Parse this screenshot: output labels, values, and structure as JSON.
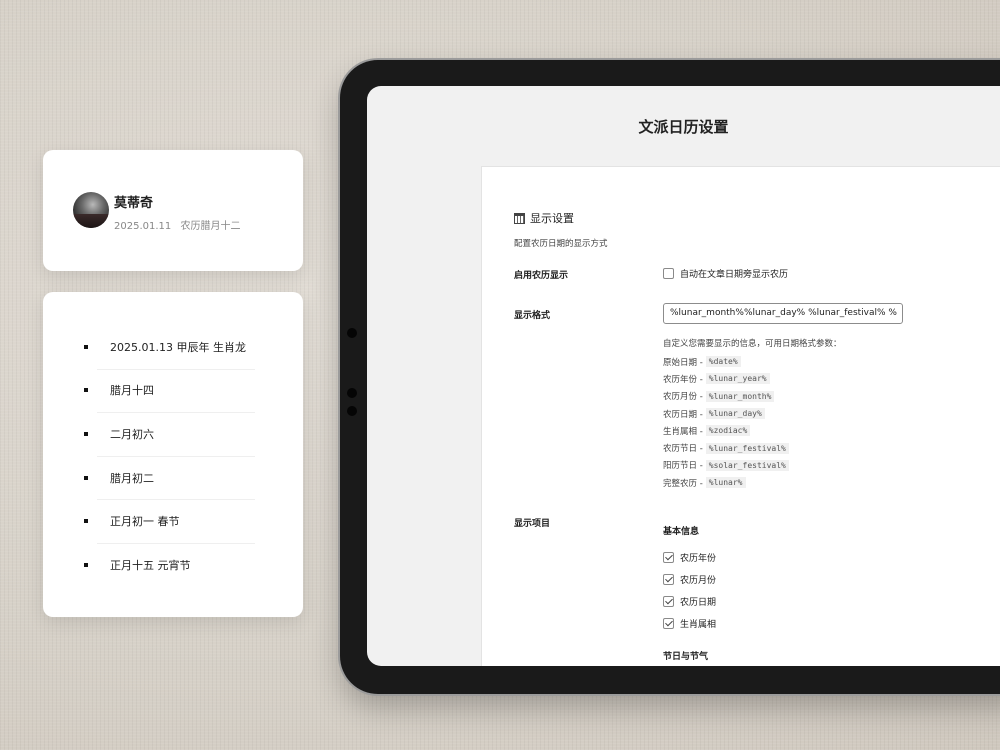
{
  "profile": {
    "name": "莫蒂奇",
    "date": "2025.01.11",
    "lunar": "农历腊月十二"
  },
  "lunar_list": [
    "2025.01.13 甲辰年 生肖龙",
    "腊月十四",
    "二月初六",
    "腊月初二",
    "正月初一 春节",
    "正月十五 元宵节"
  ],
  "settings": {
    "page_title": "文派日历设置",
    "section_title": "显示设置",
    "section_icon": "calendar-icon",
    "section_desc": "配置农历日期的显示方式",
    "enable_label": "启用农历显示",
    "enable_checkbox_label": "自动在文章日期旁显示农历",
    "enable_checked": false,
    "format_label": "显示格式",
    "format_value": "%lunar_month%%lunar_day% %lunar_festival% %",
    "help_intro": "自定义您需要显示的信息，可用日期格式参数：",
    "params": [
      {
        "label": "原始日期 -",
        "code": "%date%"
      },
      {
        "label": "农历年份 -",
        "code": "%lunar_year%"
      },
      {
        "label": "农历月份 -",
        "code": "%lunar_month%"
      },
      {
        "label": "农历日期 -",
        "code": "%lunar_day%"
      },
      {
        "label": "生肖属相 -",
        "code": "%zodiac%"
      },
      {
        "label": "农历节日 -",
        "code": "%lunar_festival%"
      },
      {
        "label": "阳历节日 -",
        "code": "%solar_festival%"
      },
      {
        "label": "完整农历 -",
        "code": "%lunar%"
      }
    ],
    "items_label": "显示项目",
    "basic_group_title": "基本信息",
    "basic_items": [
      {
        "label": "农历年份",
        "checked": true
      },
      {
        "label": "农历月份",
        "checked": true
      },
      {
        "label": "农历日期",
        "checked": true
      },
      {
        "label": "生肖属相",
        "checked": true
      }
    ],
    "festival_group_title": "节日与节气"
  }
}
